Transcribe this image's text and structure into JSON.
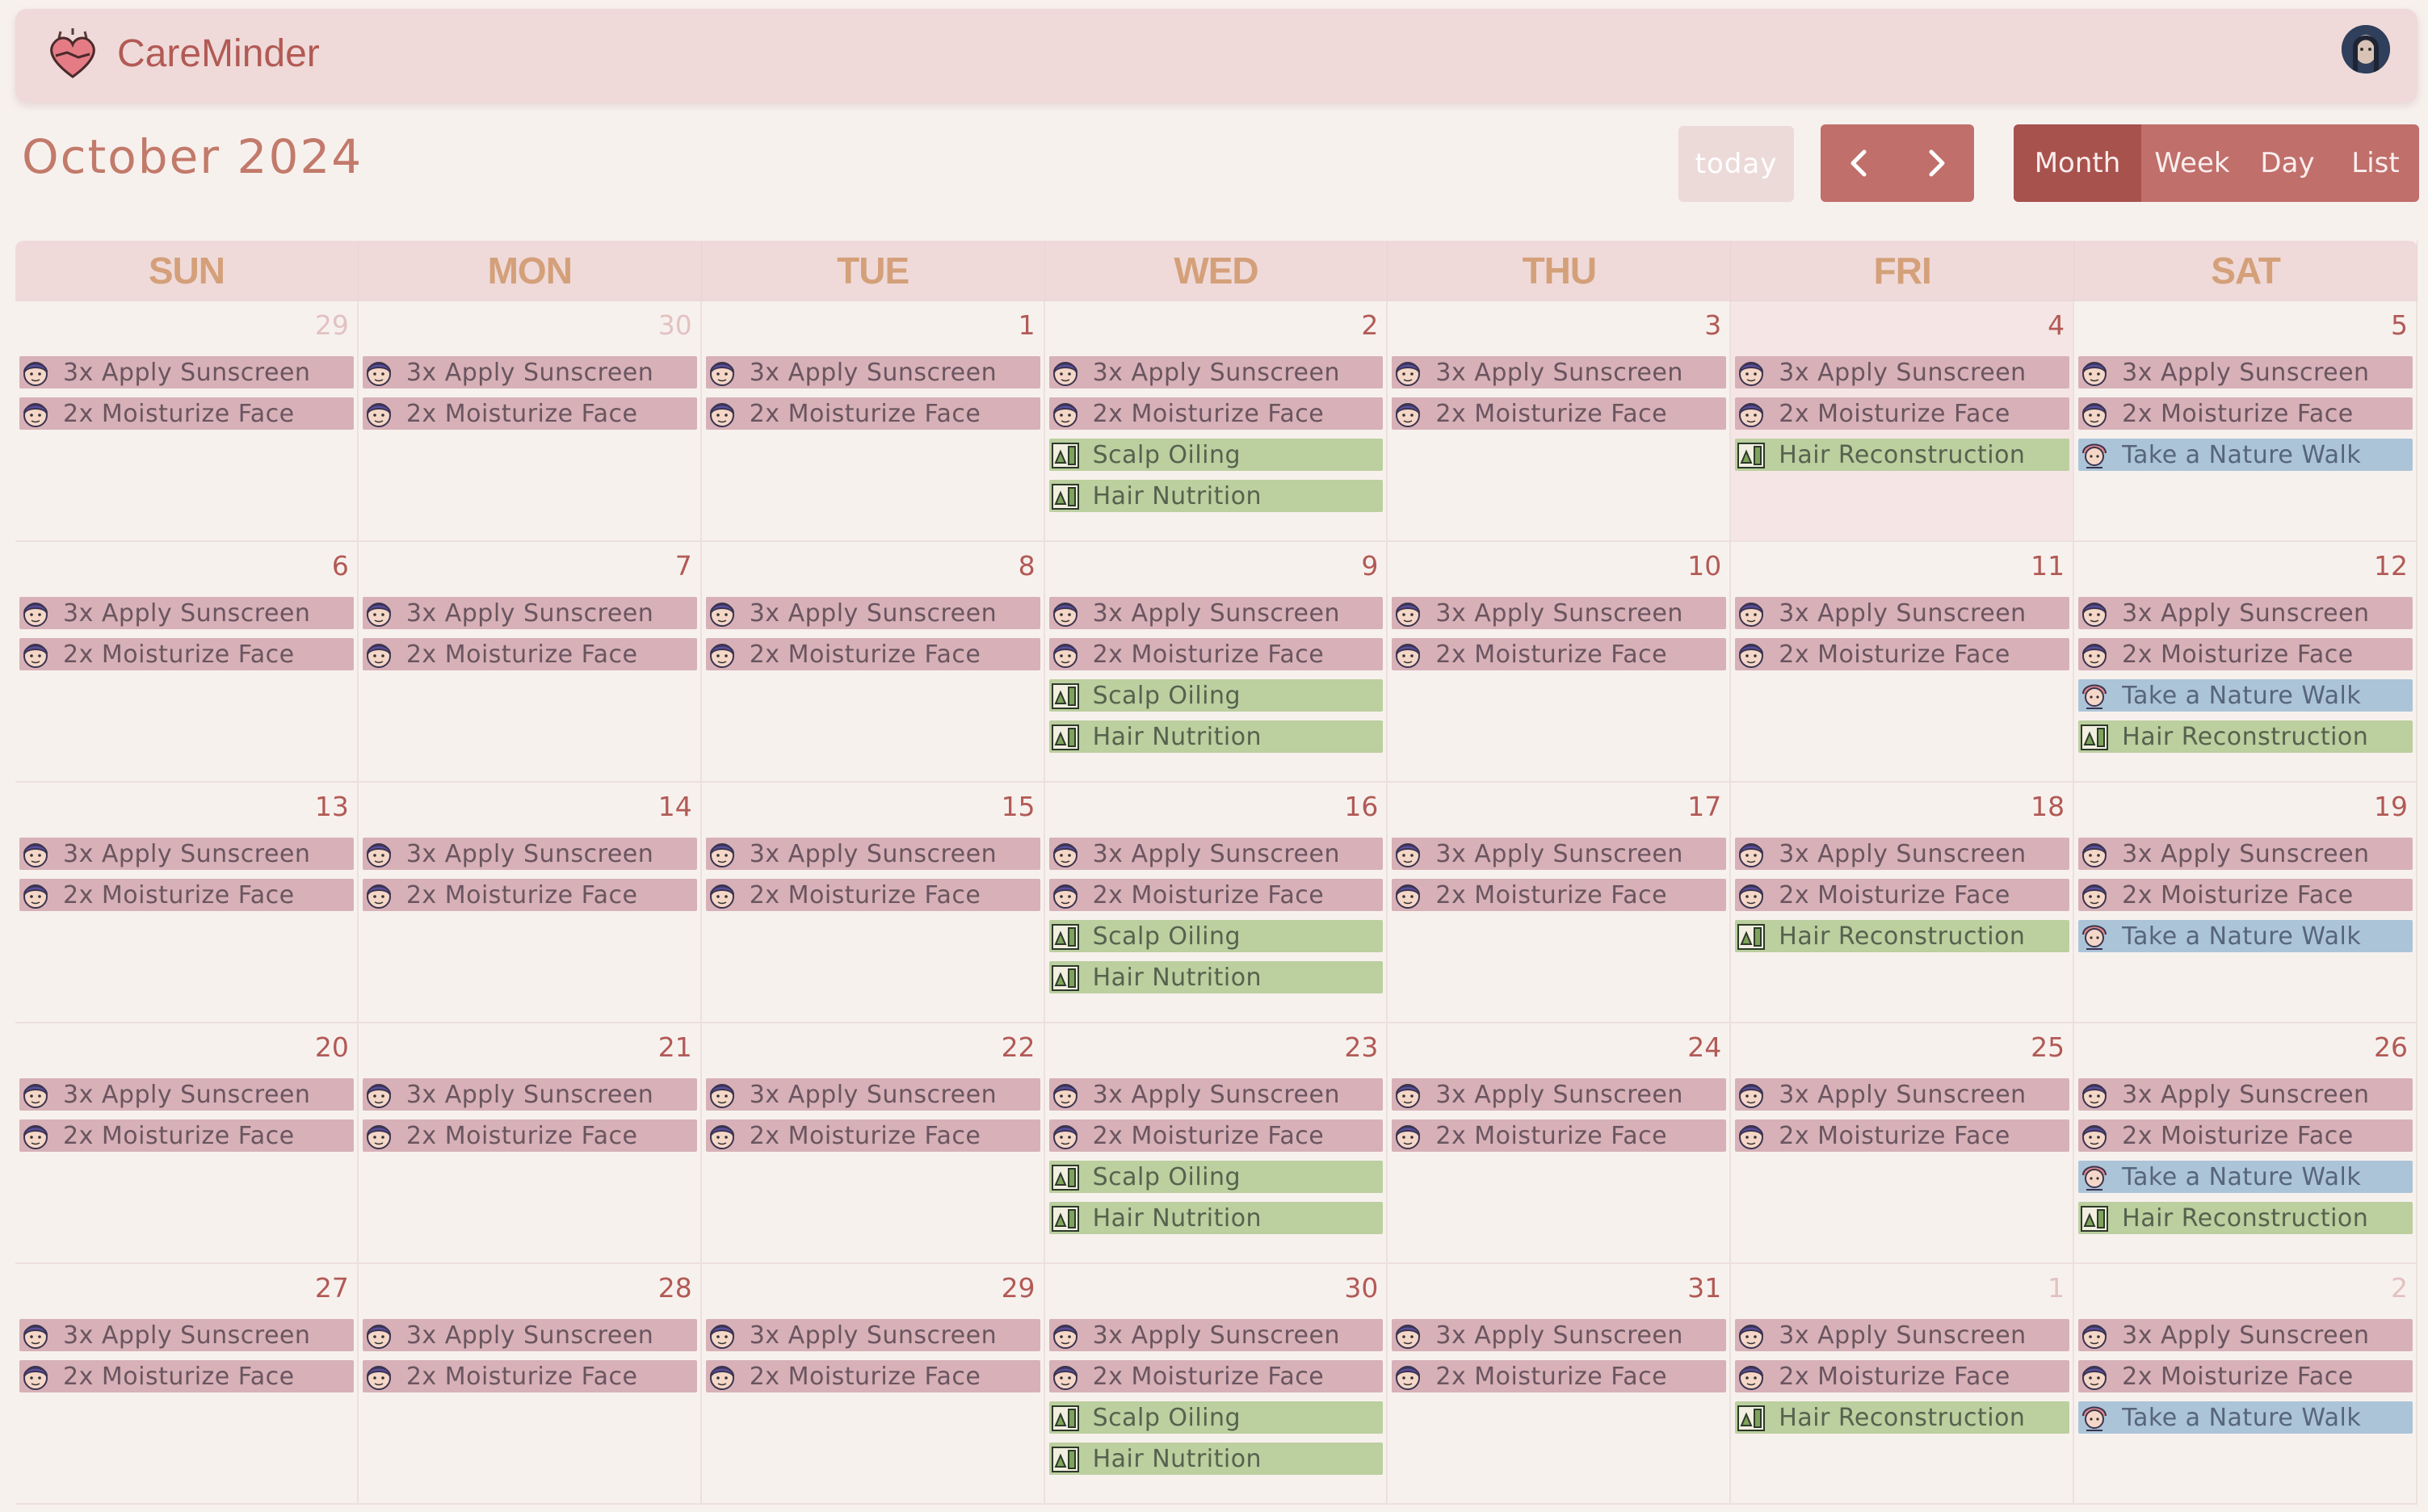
{
  "app": {
    "title": "CareMinder"
  },
  "header": {
    "month_title": "October 2024",
    "today_label": "today",
    "prev_icon": "chevron-left-icon",
    "next_icon": "chevron-right-icon",
    "views": [
      "Month",
      "Week",
      "Day",
      "List"
    ],
    "active_view": "Month"
  },
  "colors": {
    "brand": "#b25a55",
    "skincare": "#d7b1b7",
    "hair": "#bccf9f",
    "wellness": "#acc4d8"
  },
  "days_of_week": [
    "SUN",
    "MON",
    "TUE",
    "WED",
    "THU",
    "FRI",
    "SAT"
  ],
  "weeks": [
    [
      {
        "day": "29",
        "other": true,
        "events": [
          [
            "3x Apply Sunscreen",
            "pink"
          ],
          [
            "2x Moisturize Face",
            "pink"
          ]
        ]
      },
      {
        "day": "30",
        "other": true,
        "events": [
          [
            "3x Apply Sunscreen",
            "pink"
          ],
          [
            "2x Moisturize Face",
            "pink"
          ]
        ]
      },
      {
        "day": "1",
        "events": [
          [
            "3x Apply Sunscreen",
            "pink"
          ],
          [
            "2x Moisturize Face",
            "pink"
          ]
        ]
      },
      {
        "day": "2",
        "events": [
          [
            "3x Apply Sunscreen",
            "pink"
          ],
          [
            "2x Moisturize Face",
            "pink"
          ],
          [
            "Scalp Oiling",
            "green"
          ],
          [
            "Hair Nutrition",
            "green"
          ]
        ]
      },
      {
        "day": "3",
        "events": [
          [
            "3x Apply Sunscreen",
            "pink"
          ],
          [
            "2x Moisturize Face",
            "pink"
          ]
        ]
      },
      {
        "day": "4",
        "today": true,
        "events": [
          [
            "3x Apply Sunscreen",
            "pink"
          ],
          [
            "2x Moisturize Face",
            "pink"
          ],
          [
            "Hair Reconstruction",
            "green"
          ]
        ]
      },
      {
        "day": "5",
        "events": [
          [
            "3x Apply Sunscreen",
            "pink"
          ],
          [
            "2x Moisturize Face",
            "pink"
          ],
          [
            "Take a Nature Walk",
            "blue"
          ]
        ]
      }
    ],
    [
      {
        "day": "6",
        "events": [
          [
            "3x Apply Sunscreen",
            "pink"
          ],
          [
            "2x Moisturize Face",
            "pink"
          ]
        ]
      },
      {
        "day": "7",
        "events": [
          [
            "3x Apply Sunscreen",
            "pink"
          ],
          [
            "2x Moisturize Face",
            "pink"
          ]
        ]
      },
      {
        "day": "8",
        "events": [
          [
            "3x Apply Sunscreen",
            "pink"
          ],
          [
            "2x Moisturize Face",
            "pink"
          ]
        ]
      },
      {
        "day": "9",
        "events": [
          [
            "3x Apply Sunscreen",
            "pink"
          ],
          [
            "2x Moisturize Face",
            "pink"
          ],
          [
            "Scalp Oiling",
            "green"
          ],
          [
            "Hair Nutrition",
            "green"
          ]
        ]
      },
      {
        "day": "10",
        "events": [
          [
            "3x Apply Sunscreen",
            "pink"
          ],
          [
            "2x Moisturize Face",
            "pink"
          ]
        ]
      },
      {
        "day": "11",
        "events": [
          [
            "3x Apply Sunscreen",
            "pink"
          ],
          [
            "2x Moisturize Face",
            "pink"
          ]
        ]
      },
      {
        "day": "12",
        "events": [
          [
            "3x Apply Sunscreen",
            "pink"
          ],
          [
            "2x Moisturize Face",
            "pink"
          ],
          [
            "Take a Nature Walk",
            "blue"
          ],
          [
            "Hair Reconstruction",
            "green"
          ]
        ]
      }
    ],
    [
      {
        "day": "13",
        "events": [
          [
            "3x Apply Sunscreen",
            "pink"
          ],
          [
            "2x Moisturize Face",
            "pink"
          ]
        ]
      },
      {
        "day": "14",
        "events": [
          [
            "3x Apply Sunscreen",
            "pink"
          ],
          [
            "2x Moisturize Face",
            "pink"
          ]
        ]
      },
      {
        "day": "15",
        "events": [
          [
            "3x Apply Sunscreen",
            "pink"
          ],
          [
            "2x Moisturize Face",
            "pink"
          ]
        ]
      },
      {
        "day": "16",
        "events": [
          [
            "3x Apply Sunscreen",
            "pink"
          ],
          [
            "2x Moisturize Face",
            "pink"
          ],
          [
            "Scalp Oiling",
            "green"
          ],
          [
            "Hair Nutrition",
            "green"
          ]
        ]
      },
      {
        "day": "17",
        "events": [
          [
            "3x Apply Sunscreen",
            "pink"
          ],
          [
            "2x Moisturize Face",
            "pink"
          ]
        ]
      },
      {
        "day": "18",
        "events": [
          [
            "3x Apply Sunscreen",
            "pink"
          ],
          [
            "2x Moisturize Face",
            "pink"
          ],
          [
            "Hair Reconstruction",
            "green"
          ]
        ]
      },
      {
        "day": "19",
        "events": [
          [
            "3x Apply Sunscreen",
            "pink"
          ],
          [
            "2x Moisturize Face",
            "pink"
          ],
          [
            "Take a Nature Walk",
            "blue"
          ]
        ]
      }
    ],
    [
      {
        "day": "20",
        "events": [
          [
            "3x Apply Sunscreen",
            "pink"
          ],
          [
            "2x Moisturize Face",
            "pink"
          ]
        ]
      },
      {
        "day": "21",
        "events": [
          [
            "3x Apply Sunscreen",
            "pink"
          ],
          [
            "2x Moisturize Face",
            "pink"
          ]
        ]
      },
      {
        "day": "22",
        "events": [
          [
            "3x Apply Sunscreen",
            "pink"
          ],
          [
            "2x Moisturize Face",
            "pink"
          ]
        ]
      },
      {
        "day": "23",
        "events": [
          [
            "3x Apply Sunscreen",
            "pink"
          ],
          [
            "2x Moisturize Face",
            "pink"
          ],
          [
            "Scalp Oiling",
            "green"
          ],
          [
            "Hair Nutrition",
            "green"
          ]
        ]
      },
      {
        "day": "24",
        "events": [
          [
            "3x Apply Sunscreen",
            "pink"
          ],
          [
            "2x Moisturize Face",
            "pink"
          ]
        ]
      },
      {
        "day": "25",
        "events": [
          [
            "3x Apply Sunscreen",
            "pink"
          ],
          [
            "2x Moisturize Face",
            "pink"
          ]
        ]
      },
      {
        "day": "26",
        "events": [
          [
            "3x Apply Sunscreen",
            "pink"
          ],
          [
            "2x Moisturize Face",
            "pink"
          ],
          [
            "Take a Nature Walk",
            "blue"
          ],
          [
            "Hair Reconstruction",
            "green"
          ]
        ]
      }
    ],
    [
      {
        "day": "27",
        "events": [
          [
            "3x Apply Sunscreen",
            "pink"
          ],
          [
            "2x Moisturize Face",
            "pink"
          ]
        ]
      },
      {
        "day": "28",
        "events": [
          [
            "3x Apply Sunscreen",
            "pink"
          ],
          [
            "2x Moisturize Face",
            "pink"
          ]
        ]
      },
      {
        "day": "29",
        "events": [
          [
            "3x Apply Sunscreen",
            "pink"
          ],
          [
            "2x Moisturize Face",
            "pink"
          ]
        ]
      },
      {
        "day": "30",
        "events": [
          [
            "3x Apply Sunscreen",
            "pink"
          ],
          [
            "2x Moisturize Face",
            "pink"
          ],
          [
            "Scalp Oiling",
            "green"
          ],
          [
            "Hair Nutrition",
            "green"
          ]
        ]
      },
      {
        "day": "31",
        "events": [
          [
            "3x Apply Sunscreen",
            "pink"
          ],
          [
            "2x Moisturize Face",
            "pink"
          ]
        ]
      },
      {
        "day": "1",
        "other": true,
        "events": [
          [
            "3x Apply Sunscreen",
            "pink"
          ],
          [
            "2x Moisturize Face",
            "pink"
          ],
          [
            "Hair Reconstruction",
            "green"
          ]
        ]
      },
      {
        "day": "2",
        "other": true,
        "events": [
          [
            "3x Apply Sunscreen",
            "pink"
          ],
          [
            "2x Moisturize Face",
            "pink"
          ],
          [
            "Take a Nature Walk",
            "blue"
          ]
        ]
      }
    ]
  ]
}
